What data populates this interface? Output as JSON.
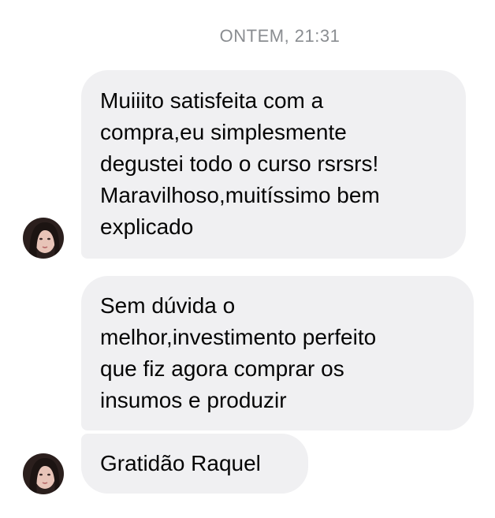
{
  "conversation": {
    "timestamp": "ONTEM, 21:31",
    "messages": [
      {
        "text": "Muiiito satisfeita com a\ncompra,eu simplesmente\ndegustei  todo o curso rsrsrs!\nMaravilhoso,muitíssimo bem\nexplicado"
      },
      {
        "text": "Sem dúvida o\nmelhor,investimento perfeito\nque fiz agora comprar os\ninsumos e produzir"
      },
      {
        "text": "Gratidão Raquel"
      }
    ]
  }
}
